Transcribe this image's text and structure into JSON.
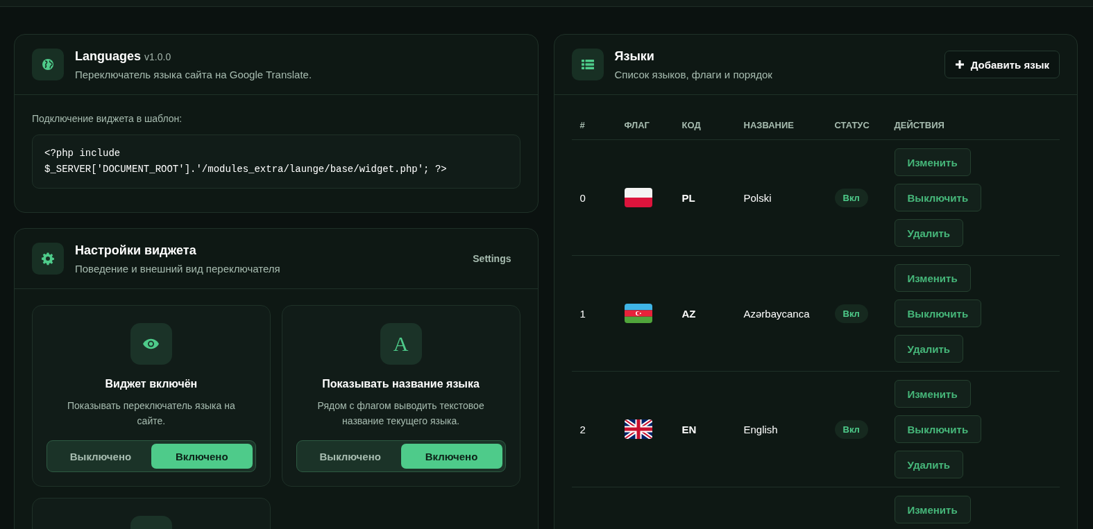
{
  "module_card": {
    "title": "Languages",
    "version": "v1.0.0",
    "subtitle": "Переключатель языка сайта на Google Translate.",
    "code_label": "Подключение виджета в шаблон:",
    "code": "<?php include $_SERVER['DOCUMENT_ROOT'].'/modules_extra/launge/base/widget.php'; ?>"
  },
  "settings_card": {
    "title": "Настройки виджета",
    "subtitle": "Поведение и внешний вид переключателя",
    "link": "Settings",
    "options": [
      {
        "kind": "eye",
        "title": "Виджет включён",
        "description": "Показывать переключатель языка на сайте.",
        "toggle": [
          {
            "label": "Выключено",
            "selected": false
          },
          {
            "label": "Включено",
            "selected": true
          }
        ]
      },
      {
        "kind": "letter",
        "icon_text": "A",
        "title": "Показывать название языка",
        "description": "Рядом с флагом выводить текстовое название текущего языка.",
        "toggle": [
          {
            "label": "Выключено",
            "selected": false
          },
          {
            "label": "Включено",
            "selected": true
          }
        ]
      },
      {
        "kind": "partial"
      }
    ]
  },
  "languages_card": {
    "title": "Языки",
    "subtitle": "Список языков, флаги и порядок",
    "add_button": "Добавить язык",
    "table": {
      "columns": [
        "#",
        "ФЛАГ",
        "КОД",
        "НАЗВАНИЕ",
        "СТАТУС",
        "ДЕЙСТВИЯ"
      ],
      "rows": [
        {
          "index": "0",
          "kind": "pl",
          "code": "PL",
          "name": "Polski",
          "status": "Вкл",
          "actions": [
            "Изменить",
            "Выключить",
            "Удалить"
          ]
        },
        {
          "index": "1",
          "kind": "az",
          "code": "AZ",
          "name": "Azərbaycanca",
          "status": "Вкл",
          "actions": [
            "Изменить",
            "Выключить",
            "Удалить"
          ]
        },
        {
          "index": "2",
          "kind": "gb",
          "code": "EN",
          "name": "English",
          "status": "Вкл",
          "actions": [
            "Изменить",
            "Выключить",
            "Удалить"
          ]
        },
        {
          "actions": [
            "Изменить"
          ]
        }
      ]
    }
  }
}
